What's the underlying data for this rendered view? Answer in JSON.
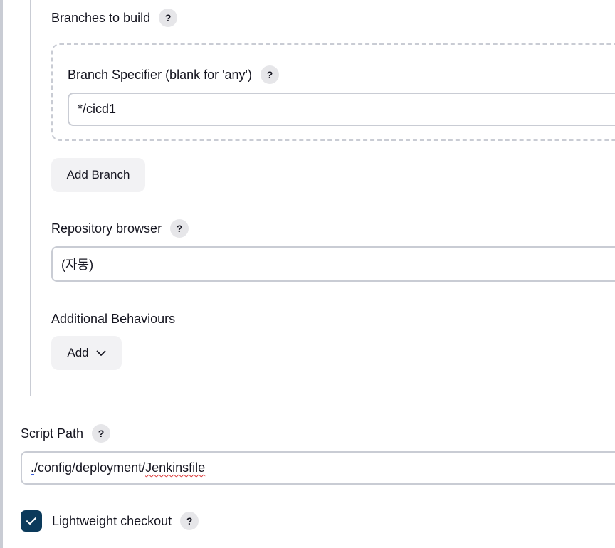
{
  "branches": {
    "section_label": "Branches to build",
    "specifier_label": "Branch Specifier (blank for 'any')",
    "specifier_value": "*/cicd1",
    "add_branch_label": "Add Branch"
  },
  "repository_browser": {
    "label": "Repository browser",
    "selected_value": "(자동)"
  },
  "additional_behaviours": {
    "label": "Additional Behaviours",
    "add_label": "Add"
  },
  "script_path": {
    "label": "Script Path",
    "value_prefix": ".",
    "value_mid": "/config/deployment/",
    "value_word": "Jenkinsfile"
  },
  "lightweight_checkout": {
    "label": "Lightweight checkout",
    "checked": true
  },
  "help_text": "?",
  "colors": {
    "checkbox_fill": "#0b3a5b",
    "border": "#c9ccd4",
    "button_bg": "#f2f2f4",
    "help_bg": "#e6e6e9"
  }
}
